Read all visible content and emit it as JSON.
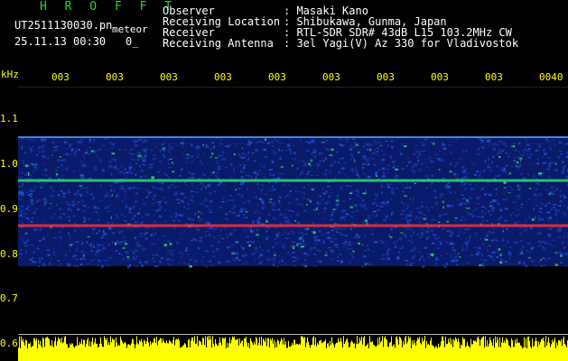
{
  "header": {
    "title": "H R O F F T",
    "file_name": "UT2511130030.pn",
    "meteor_label": "meteor",
    "date_time": "25.11.13 00:30",
    "corner_value": "0_"
  },
  "info": {
    "observer_label": "Observer",
    "observer_value": ": Masaki Kano",
    "location_label": "Receiving Location",
    "location_value": ": Shibukawa, Gunma, Japan",
    "receiver_label": "Receiver",
    "receiver_value": ": RTL-SDR SDR# 43dB L15 103.2MHz CW",
    "antenna_label": "Receiving Antenna",
    "antenna_value": ": 3el Yagi(V) Az 330 for Vladivostok"
  },
  "axis": {
    "unit": "kHz",
    "freq_ticks": [
      "1.1",
      "1.0",
      "0.9",
      "0.8",
      "0.7",
      "0.6"
    ],
    "time_ticks": [
      "003",
      "003",
      "003",
      "003",
      "003",
      "003",
      "003",
      "003",
      "003",
      "0040"
    ]
  },
  "colors": {
    "background": "#000000",
    "header_green": "#22dd22",
    "axis_yellow": "#ffff00",
    "spectrum_blue": "#1e50d8",
    "signal_green": "#30e060",
    "signal_red": "#ff3030"
  },
  "spectrogram": {
    "freq_range_khz": [
      0.6,
      1.15
    ],
    "band_khz": [
      0.77,
      1.055
    ],
    "carrier_lines_khz": [
      0.86,
      0.96,
      1.055
    ]
  }
}
